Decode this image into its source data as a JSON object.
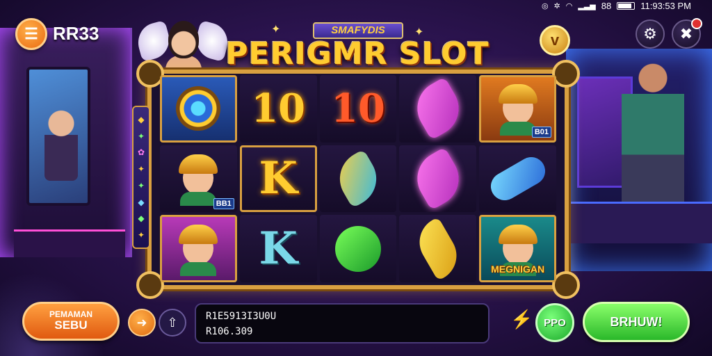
{
  "status_bar": {
    "time": "11:93:53 PM",
    "signal_text": "88"
  },
  "header": {
    "brand": "RR33",
    "menu_icon": "hamburger-icon",
    "settings_icon": "gear-icon",
    "close_icon": "close-icon"
  },
  "title": {
    "banner": "SMAFYDIS",
    "main": "PERIGMR SLOT"
  },
  "coin_icon": "v",
  "reels": [
    [
      {
        "kind": "compass",
        "name": "compass-symbol",
        "framed": true
      },
      {
        "kind": "char",
        "name": "warrior-symbol",
        "tag": "BB1"
      },
      {
        "kind": "char",
        "name": "helmet-hero-symbol",
        "framed": true
      }
    ],
    [
      {
        "kind": "text",
        "text": "10",
        "style": "sym-10",
        "name": "ten-gold-symbol"
      },
      {
        "kind": "text",
        "text": "K",
        "style": "sym-k",
        "name": "king-gold-symbol",
        "framed": true
      },
      {
        "kind": "text",
        "text": "K",
        "style": "sym-k teal",
        "name": "king-teal-symbol"
      }
    ],
    [
      {
        "kind": "text",
        "text": "10",
        "style": "sym-10 red",
        "name": "ten-red-symbol"
      },
      {
        "kind": "ribbon",
        "style": "mixed",
        "name": "ribbon-mixed-symbol"
      },
      {
        "kind": "ribbon",
        "style": "green",
        "name": "g-green-symbol"
      }
    ],
    [
      {
        "kind": "ribbon",
        "style": "pink",
        "name": "ribbon-pink-symbol"
      },
      {
        "kind": "ribbon",
        "style": "pink",
        "name": "ribbon-magenta-symbol"
      },
      {
        "kind": "ribbon",
        "style": "yellow",
        "name": "ribbon-yellow-symbol"
      }
    ],
    [
      {
        "kind": "char",
        "name": "hero-symbol",
        "tag": "B01",
        "framed": true
      },
      {
        "kind": "ribbon",
        "style": "blue",
        "name": "ring-blue-symbol"
      },
      {
        "kind": "char",
        "name": "megnigan-symbol",
        "label": "MEGNIGAN",
        "framed": true
      }
    ]
  ],
  "side_strip_glyphs": [
    "◆",
    "✦",
    "✿",
    "✦",
    "✦",
    "◆",
    "◆",
    "✦"
  ],
  "controls": {
    "left_button": {
      "line1": "PEMAMAN",
      "line2": "SEBU"
    },
    "arrow_icon": "arrow-right-icon",
    "upload_icon": "upload-icon",
    "info_line1": "R1E5913I3U0U",
    "info_line2": "R106.309",
    "bolt_icon": "bolt-icon",
    "auto_label": "PPO",
    "spin_label": "BRHUW!"
  }
}
